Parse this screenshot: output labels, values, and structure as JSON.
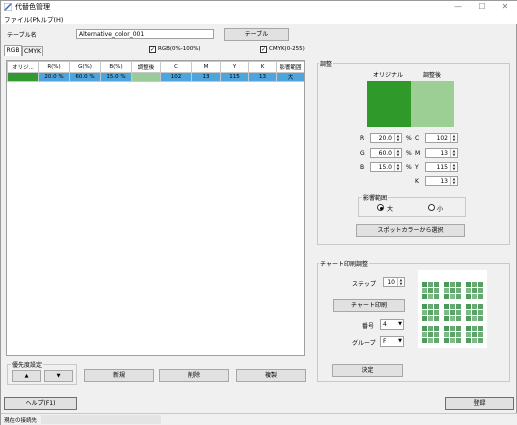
{
  "window": {
    "title": "代替色管理",
    "controls": {
      "minimize": "—",
      "maximize": "☐",
      "close": "✕"
    }
  },
  "menu": [
    {
      "label": "ファイル(F)"
    },
    {
      "label": "ヘルプ(H)"
    }
  ],
  "table_name": {
    "label": "テーブル名",
    "value": "Alternative_color_001",
    "button": "テーブル"
  },
  "tabs": [
    {
      "label": "RGB",
      "active": true
    },
    {
      "label": "CMYK",
      "active": false
    }
  ],
  "display_options": {
    "rgb_percent": {
      "label": "RGB(0%-100%)",
      "checked": true
    },
    "cmyk_255": {
      "label": "CMYK(0-255)",
      "checked": true
    }
  },
  "table": {
    "columns": [
      "オリジ...",
      "R(%)",
      "G(%)",
      "B(%)",
      "調整後",
      "C",
      "M",
      "Y",
      "K",
      "影響範囲"
    ],
    "rows": [
      {
        "original_swatch": "#339933",
        "r": "20.0 %",
        "g": "60.0 %",
        "b": "15.0 %",
        "adjusted_swatch": "#99cc99",
        "c": "102",
        "m": "13",
        "y": "115",
        "k": "13",
        "range": "大",
        "selected": true
      }
    ]
  },
  "priority": {
    "label": "優先度設定",
    "up": "▲",
    "down": "▼"
  },
  "actions": {
    "new": "新規",
    "delete": "削除",
    "duplicate": "複製"
  },
  "adjust": {
    "label": "調整",
    "original_label": "オリジナル",
    "adjusted_label": "調整後",
    "original_color": "#2f9a2a",
    "adjusted_color": "#9ccf94",
    "rgb": [
      {
        "label": "R",
        "value": "20.0",
        "unit": "%"
      },
      {
        "label": "G",
        "value": "60.0",
        "unit": "%"
      },
      {
        "label": "B",
        "value": "15.0",
        "unit": "%"
      }
    ],
    "cmyk": [
      {
        "label": "C",
        "value": "102"
      },
      {
        "label": "M",
        "value": "13"
      },
      {
        "label": "Y",
        "value": "115"
      },
      {
        "label": "K",
        "value": "13"
      }
    ],
    "influence": {
      "label": "影響範囲",
      "options": [
        {
          "label": "大",
          "selected": true
        },
        {
          "label": "小",
          "selected": false
        }
      ]
    },
    "spot_button": "スポットカラーから選択"
  },
  "chart": {
    "label": "チャート印刷調整",
    "step_label": "ステップ",
    "step_value": "10",
    "print_button": "チャート印刷",
    "number_label": "番号",
    "number_value": "4",
    "group_label": "グループ",
    "group_value": "F",
    "decide_button": "決定"
  },
  "bottom": {
    "help_button": "ヘルプ(F1)",
    "register_button": "登録"
  },
  "status": {
    "label": "現在の接続先",
    "value": ""
  }
}
